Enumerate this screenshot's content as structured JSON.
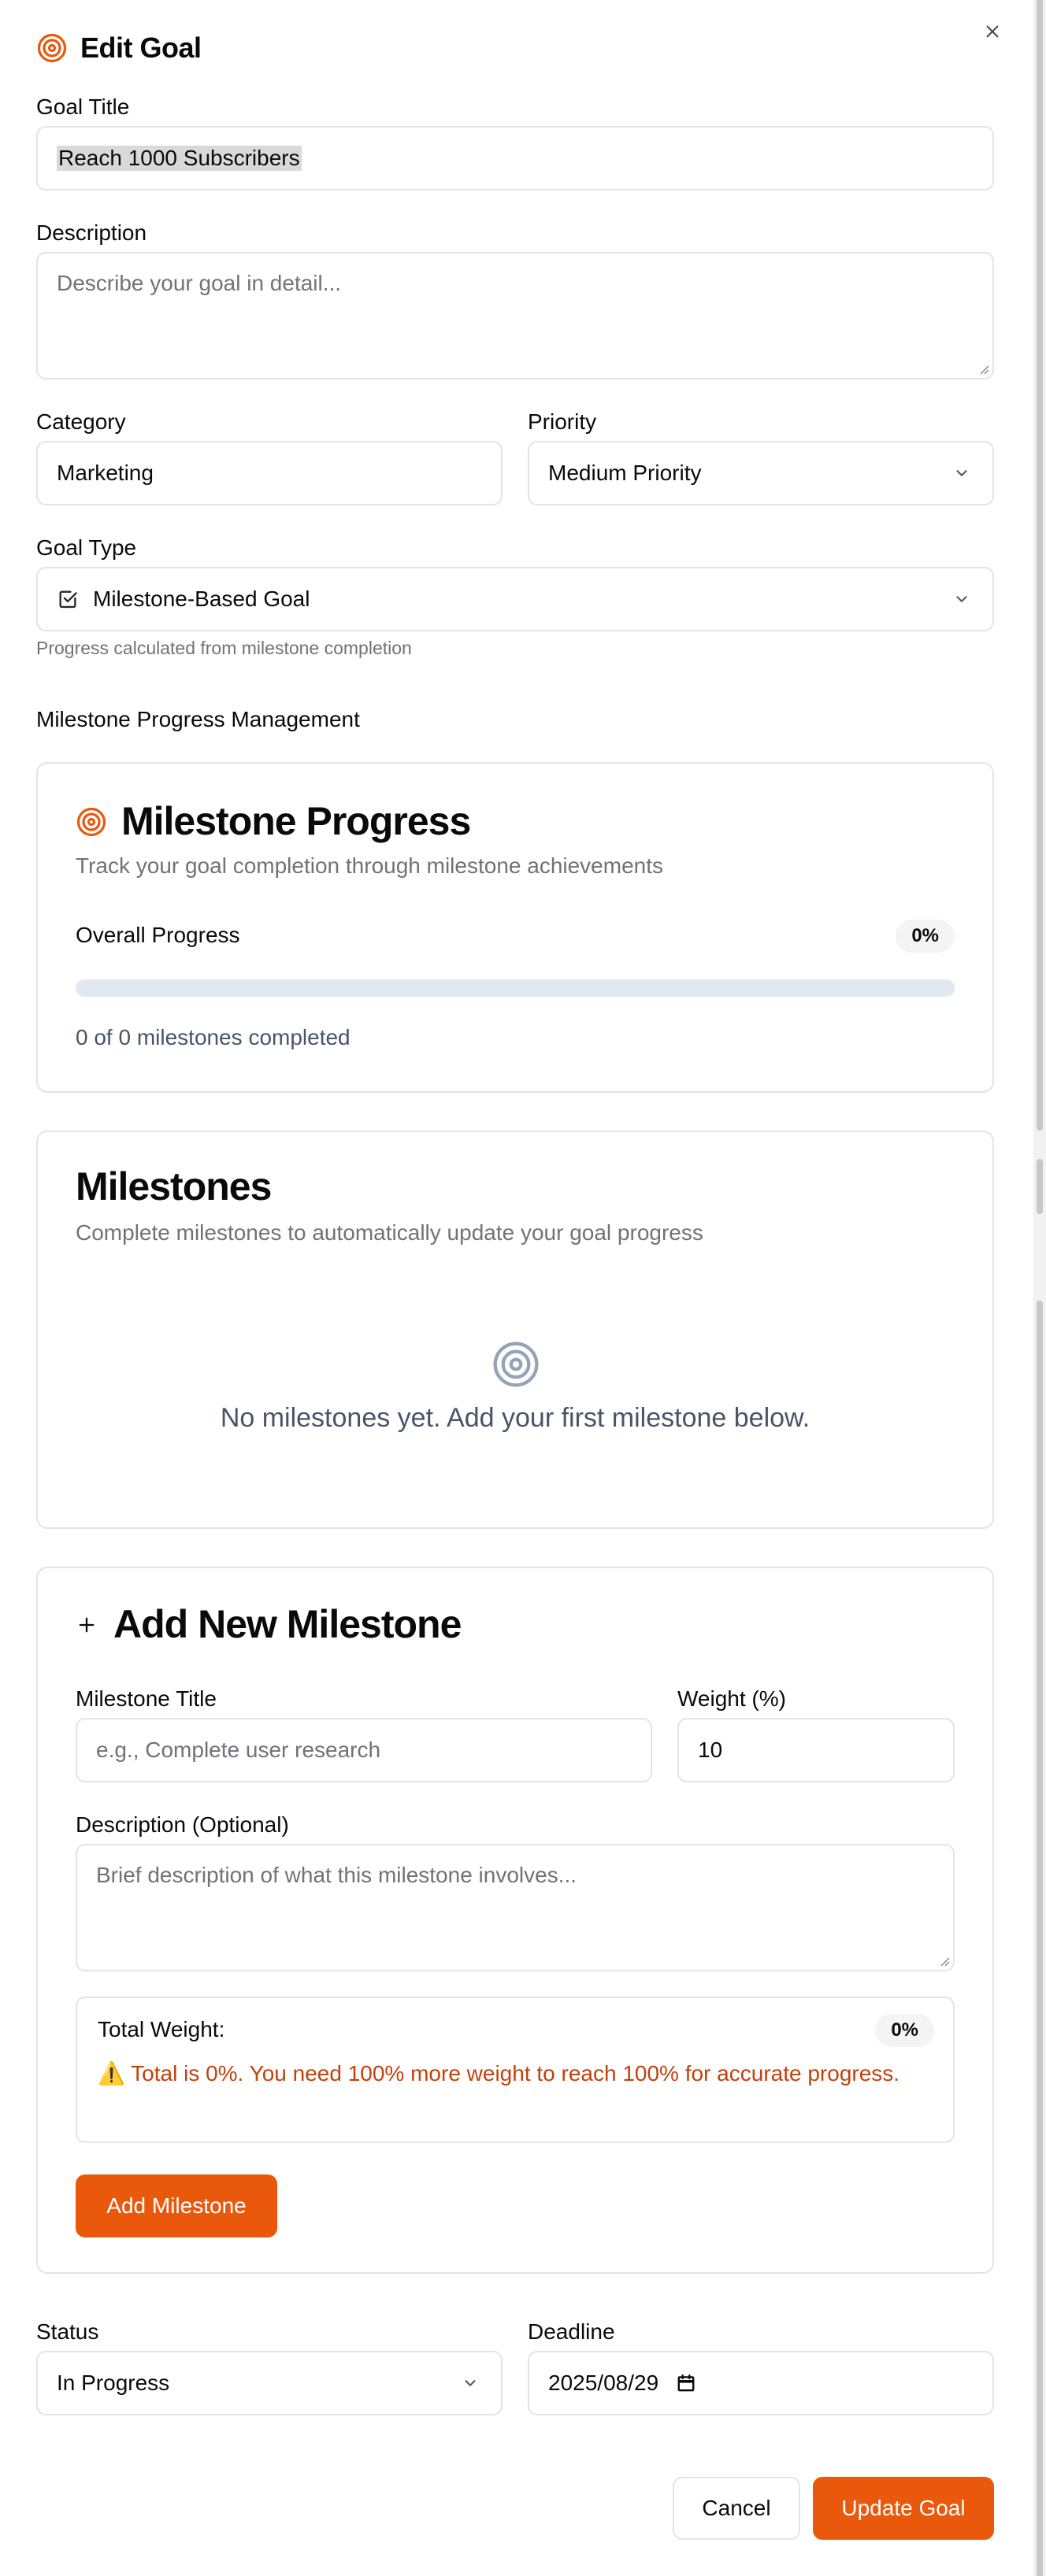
{
  "dialog": {
    "title": "Edit Goal",
    "title_icon": "target-icon",
    "close_icon": "close-icon"
  },
  "goal_title": {
    "label": "Goal Title",
    "value": "Reach 1000 Subscribers"
  },
  "description": {
    "label": "Description",
    "placeholder": "Describe your goal in detail..."
  },
  "category": {
    "label": "Category",
    "value": "Marketing"
  },
  "priority": {
    "label": "Priority",
    "value": "Medium Priority"
  },
  "goal_type": {
    "label": "Goal Type",
    "value": "Milestone-Based Goal",
    "icon": "checkbox-icon",
    "hint": "Progress calculated from milestone completion"
  },
  "milestone_management": {
    "heading": "Milestone Progress Management"
  },
  "milestone_progress": {
    "title": "Milestone Progress",
    "subtitle": "Track your goal completion through milestone achievements",
    "overall_label": "Overall Progress",
    "percent_text": "0%",
    "progress_fraction": 0,
    "completed_text": "0 of 0 milestones completed"
  },
  "milestones": {
    "title": "Milestones",
    "subtitle": "Complete milestones to automatically update your goal progress",
    "empty_text": "No milestones yet. Add your first milestone below."
  },
  "add_milestone": {
    "title": "Add New Milestone",
    "title_label_text": "Milestone Title",
    "title_placeholder": "e.g., Complete user research",
    "weight_label": "Weight (%)",
    "weight_value": "10",
    "description_label": "Description (Optional)",
    "description_placeholder": "Brief description of what this milestone involves...",
    "total_weight_label": "Total Weight:",
    "total_weight_badge": "0%",
    "warning_emoji": "⚠️",
    "warning_text": "Total is 0%. You need 100% more weight to reach 100% for accurate progress.",
    "button_label": "Add Milestone"
  },
  "status": {
    "label": "Status",
    "value": "In Progress"
  },
  "deadline": {
    "label": "Deadline",
    "value": "2025/08/29"
  },
  "footer": {
    "cancel_label": "Cancel",
    "update_label": "Update Goal"
  },
  "colors": {
    "accent": "#ea580c",
    "border": "#e4e4e7",
    "muted_text": "#71717a",
    "progress_track": "#e2e8f0",
    "warning_text": "#c2410c"
  }
}
